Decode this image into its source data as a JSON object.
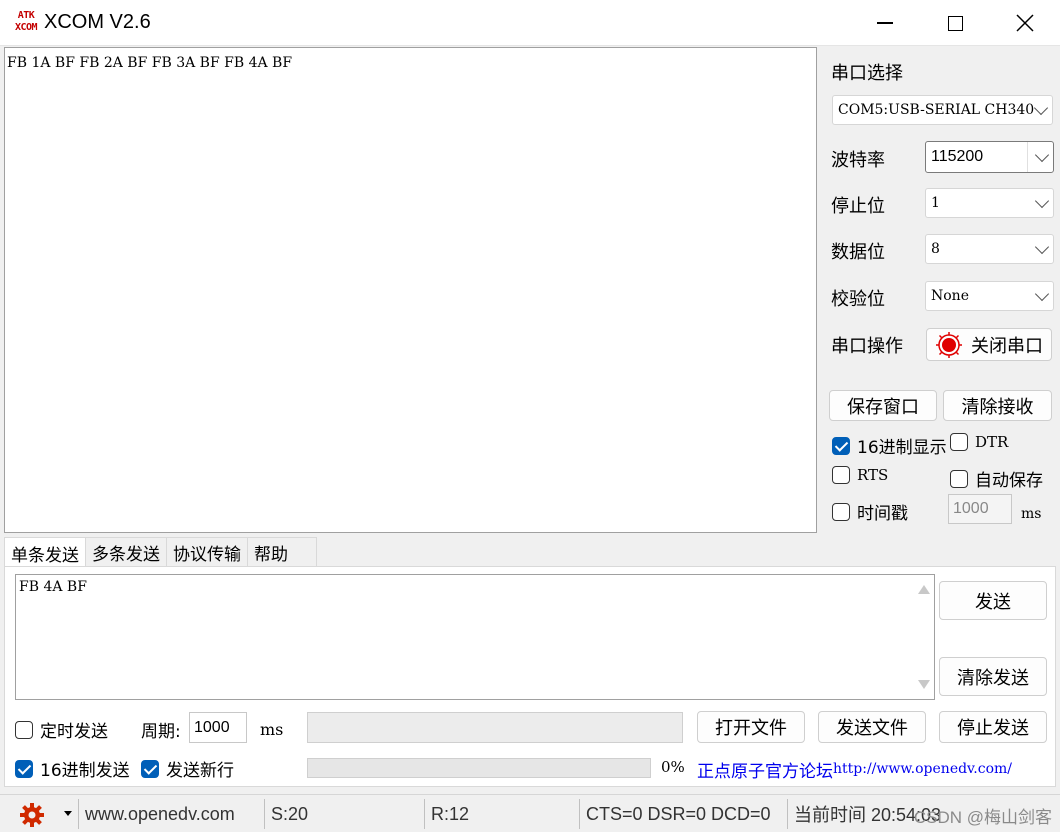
{
  "window": {
    "logo_top": "ATK",
    "logo_bottom": "XCOM",
    "title": "XCOM V2.6"
  },
  "receive": {
    "text": "FB 1A BF FB 2A BF FB 3A BF FB 4A BF"
  },
  "serial": {
    "port_select_label": "串口选择",
    "port_value": "COM5:USB-SERIAL CH340",
    "baud_label": "波特率",
    "baud_value": "115200",
    "stopbits_label": "停止位",
    "stopbits_value": "1",
    "databits_label": "数据位",
    "databits_value": "8",
    "parity_label": "校验位",
    "parity_value": "None",
    "operation_label": "串口操作",
    "toggle_port_button": "关闭串口",
    "port_open": true,
    "save_window_button": "保存窗口",
    "clear_receive_button": "清除接收",
    "hex_display_label": "16进制显示",
    "hex_display_checked": true,
    "dtr_label": "DTR",
    "rts_label": "RTS",
    "auto_save_label": "自动保存",
    "timestamp_label": "时间戳",
    "timestamp_interval": "1000",
    "timestamp_unit": "ms"
  },
  "tabs": [
    "单条发送",
    "多条发送",
    "协议传输",
    "帮助"
  ],
  "send": {
    "text": "FB 4A BF",
    "send_button": "发送",
    "clear_send_button": "清除发送",
    "timed_send_label": "定时发送",
    "timed_send_checked": false,
    "period_label": "周期:",
    "period_value": "1000",
    "period_unit": "ms",
    "open_file_button": "打开文件",
    "send_file_button": "发送文件",
    "stop_send_button": "停止发送",
    "hex_send_label": "16进制发送",
    "hex_send_checked": true,
    "newline_label": "发送新行",
    "newline_checked": true,
    "progress_text": "0%",
    "progress_fraction": 0,
    "forum_link_text": "正点原子官方论坛",
    "forum_link_url": "http://www.openedv.com/"
  },
  "status": {
    "website": "www.openedv.com",
    "sent": "S:20",
    "received": "R:12",
    "signals": "CTS=0 DSR=0 DCD=0",
    "time": "当前时间 20:54:03",
    "watermark": "CSDN @梅山剑客"
  },
  "colors": {
    "accent": "#005fb8",
    "link": "#0000ee",
    "status_indicator": "#e00000"
  }
}
